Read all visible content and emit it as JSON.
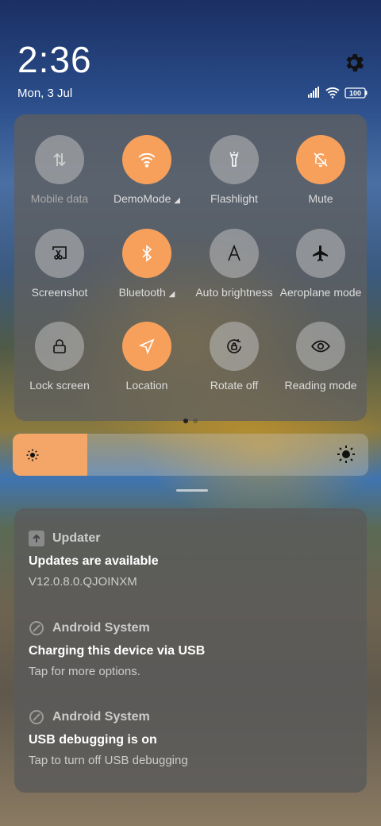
{
  "status": {
    "time": "2:36",
    "date": "Mon, 3 Jul",
    "battery": "100"
  },
  "tiles": [
    {
      "label": "Mobile data",
      "icon": "mobile-data-icon",
      "active": false
    },
    {
      "label": "DemoMode",
      "icon": "wifi-icon",
      "active": true,
      "expandable": true
    },
    {
      "label": "Flashlight",
      "icon": "flashlight-icon",
      "active": false
    },
    {
      "label": "Mute",
      "icon": "bell-off-icon",
      "active": true
    },
    {
      "label": "Screenshot",
      "icon": "screenshot-icon",
      "active": false
    },
    {
      "label": "Bluetooth",
      "icon": "bluetooth-icon",
      "active": true,
      "expandable": true
    },
    {
      "label": "Auto brightness",
      "icon": "auto-brightness-icon",
      "active": false
    },
    {
      "label": "Aeroplane mode",
      "icon": "airplane-icon",
      "active": false
    },
    {
      "label": "Lock screen",
      "icon": "lock-icon",
      "active": false
    },
    {
      "label": "Location",
      "icon": "location-icon",
      "active": true
    },
    {
      "label": "Rotate off",
      "icon": "rotate-lock-icon",
      "active": false
    },
    {
      "label": "Reading mode",
      "icon": "eye-icon",
      "active": false
    }
  ],
  "page_indicator": {
    "pages": 2,
    "current": 1
  },
  "brightness": {
    "level": 0.21
  },
  "notifications": [
    {
      "app": "Updater",
      "icon": "updater-icon",
      "title": "Updates are available",
      "text": "V12.0.8.0.QJOINXM"
    },
    {
      "app": "Android System",
      "icon": "android-system-icon",
      "title": "Charging this device via USB",
      "text": "Tap for more options."
    },
    {
      "app": "Android System",
      "icon": "android-system-icon",
      "title": "USB debugging is on",
      "text": "Tap to turn off USB debugging"
    }
  ],
  "colors": {
    "accent": "#f7a05c",
    "tile_off": "#9a9a9a",
    "panel": "#5f5f5f"
  }
}
